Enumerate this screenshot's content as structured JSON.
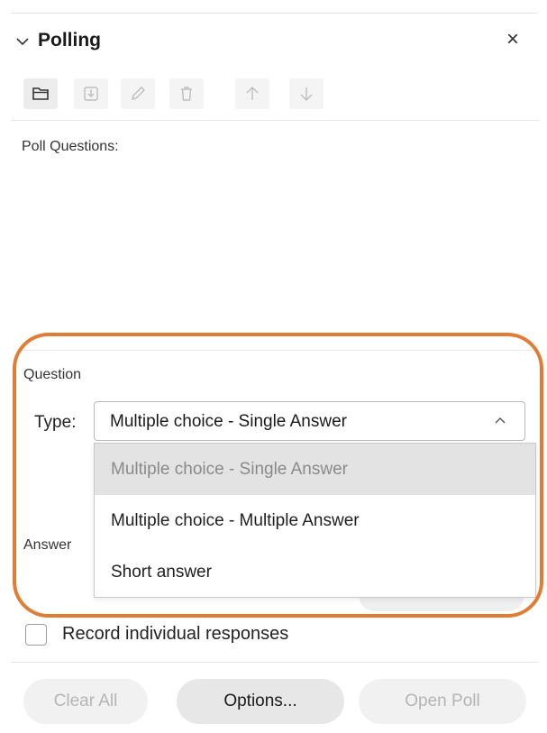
{
  "header": {
    "title": "Polling",
    "close_glyph": "×"
  },
  "toolbar": {
    "buttons": [
      {
        "icon": "folder-icon",
        "state": "active"
      },
      {
        "icon": "import-icon",
        "state": "disabled"
      },
      {
        "icon": "edit-icon",
        "state": "disabled"
      },
      {
        "icon": "delete-icon",
        "state": "disabled"
      },
      {
        "icon": "move-up-icon",
        "state": "disabled"
      },
      {
        "icon": "move-down-icon",
        "state": "disabled"
      }
    ]
  },
  "poll_questions": {
    "label": "Poll Questions:"
  },
  "question": {
    "section_label": "Question",
    "type_label": "Type:",
    "type_value": "Multiple choice - Single Answer",
    "dropdown_open": true,
    "options": [
      {
        "label": "Multiple choice - Single Answer",
        "selected": true
      },
      {
        "label": "Multiple choice - Multiple Answer",
        "selected": false
      },
      {
        "label": "Short answer",
        "selected": false
      }
    ]
  },
  "answer": {
    "section_label": "Answer"
  },
  "record": {
    "label": "Record individual responses",
    "checked": false
  },
  "footer": {
    "clear_all": "Clear All",
    "options": "Options...",
    "open_poll": "Open Poll"
  },
  "colors": {
    "highlight": "#e37c33"
  }
}
